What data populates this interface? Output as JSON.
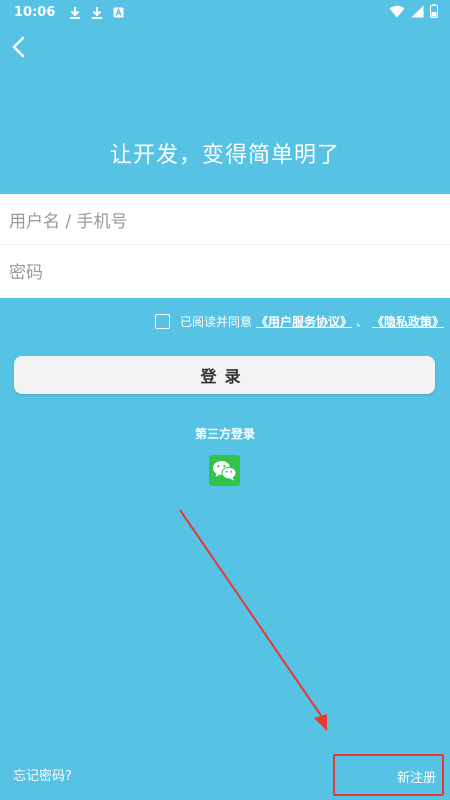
{
  "status_bar": {
    "time": "10:06"
  },
  "header": {
    "slogan": "让开发，变得简单明了"
  },
  "form": {
    "username_placeholder": "用户名 / 手机号",
    "password_placeholder": "密码"
  },
  "agreement": {
    "prefix": "已阅读并同意",
    "service_link": "《用户服务协议》",
    "separator": "、",
    "privacy_link": "《隐私政策》"
  },
  "login_button": "登录",
  "third_party": {
    "label": "第三方登录",
    "icon": "wechat-icon"
  },
  "footer": {
    "forgot_password": "忘记密码?",
    "register": "新注册"
  },
  "colors": {
    "background": "#56c2e4",
    "wechat": "#34c34a",
    "highlight": "#e53935"
  }
}
